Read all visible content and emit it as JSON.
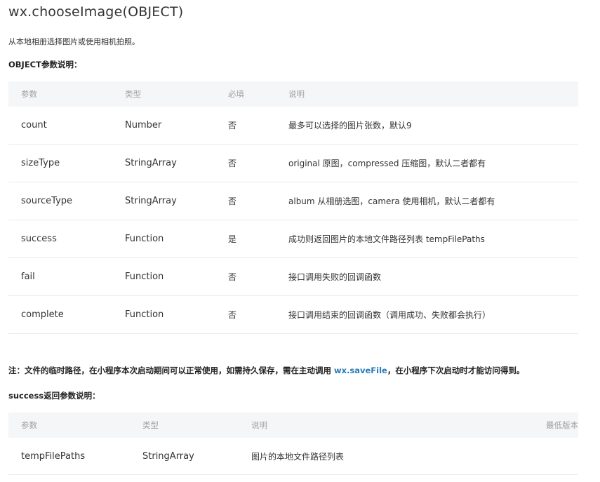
{
  "title": "wx.chooseImage(OBJECT)",
  "description": "从本地相册选择图片或使用相机拍照。",
  "params_heading": "OBJECT参数说明：",
  "params_table": {
    "headers": [
      "参数",
      "类型",
      "必填",
      "说明"
    ],
    "rows": [
      [
        "count",
        "Number",
        "否",
        "最多可以选择的图片张数，默认9"
      ],
      [
        "sizeType",
        "StringArray",
        "否",
        "original 原图，compressed 压缩图，默认二者都有"
      ],
      [
        "sourceType",
        "StringArray",
        "否",
        "album 从相册选图，camera 使用相机，默认二者都有"
      ],
      [
        "success",
        "Function",
        "是",
        "成功则返回图片的本地文件路径列表 tempFilePaths"
      ],
      [
        "fail",
        "Function",
        "否",
        "接口调用失败的回调函数"
      ],
      [
        "complete",
        "Function",
        "否",
        "接口调用结束的回调函数（调用成功、失败都会执行）"
      ]
    ]
  },
  "note": {
    "before": "注：文件的临时路径，在小程序本次启动期间可以正常使用，如需持久保存，需在主动调用 ",
    "link": "wx.saveFile",
    "after": "，在小程序下次启动时才能访问得到。"
  },
  "success_heading": "success返回参数说明：",
  "success_table": {
    "headers": [
      "参数",
      "类型",
      "说明",
      "最低版本"
    ],
    "rows": [
      [
        "tempFilePaths",
        "StringArray",
        "图片的本地文件路径列表",
        ""
      ]
    ]
  }
}
